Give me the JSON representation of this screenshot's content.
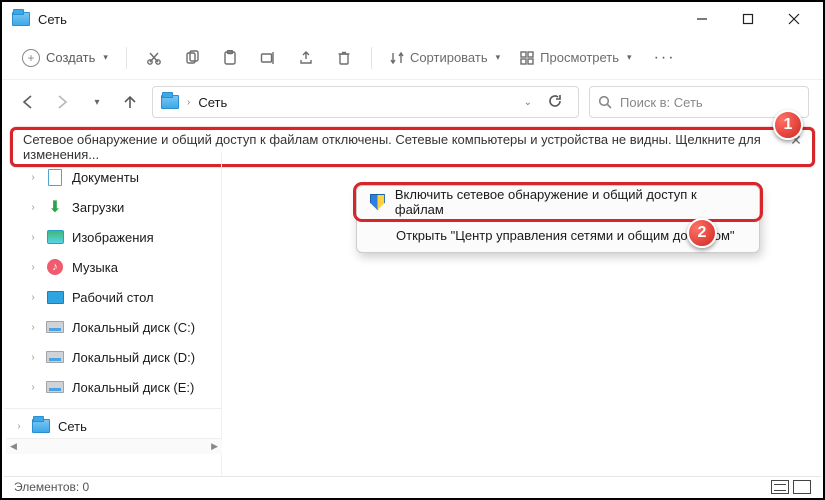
{
  "window": {
    "title": "Сеть"
  },
  "toolbar": {
    "create_label": "Создать",
    "sort_label": "Сортировать",
    "view_label": "Просмотреть"
  },
  "nav": {
    "address_label": "Сеть",
    "search_placeholder": "Поиск в: Сеть"
  },
  "infobar": {
    "message": "Сетевое обнаружение и общий доступ к файлам отключены. Сетевые компьютеры и устройства не видны. Щелкните для изменения..."
  },
  "context_menu": {
    "items": [
      {
        "label": "Включить сетевое обнаружение и общий доступ к файлам"
      },
      {
        "label": "Открыть \"Центр управления сетями и общим доступом\""
      }
    ]
  },
  "sidebar": {
    "items": [
      {
        "label": "Документы"
      },
      {
        "label": "Загрузки"
      },
      {
        "label": "Изображения"
      },
      {
        "label": "Музыка"
      },
      {
        "label": "Рабочий стол"
      },
      {
        "label": "Локальный диск (C:)"
      },
      {
        "label": "Локальный диск (D:)"
      },
      {
        "label": "Локальный диск (E:)"
      }
    ],
    "bottom_item": "Сеть"
  },
  "statusbar": {
    "text": "Элементов: 0"
  },
  "markers": {
    "m1": "1",
    "m2": "2"
  }
}
